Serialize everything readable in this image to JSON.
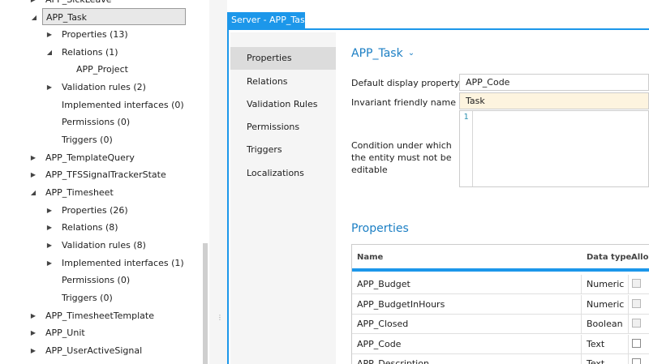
{
  "tree": {
    "items": [
      {
        "label": "APP_SickLeave",
        "expander": "expand"
      },
      {
        "label": "APP_Task",
        "expander": "collapse",
        "selected": true
      },
      {
        "label": "Properties (13)",
        "expander": "expand"
      },
      {
        "label": "Relations (1)",
        "expander": "collapse"
      },
      {
        "label": "APP_Project",
        "expander": "none"
      },
      {
        "label": "Validation rules (2)",
        "expander": "expand"
      },
      {
        "label": "Implemented interfaces (0)",
        "expander": "none"
      },
      {
        "label": "Permissions (0)",
        "expander": "none"
      },
      {
        "label": "Triggers (0)",
        "expander": "none"
      },
      {
        "label": "APP_TemplateQuery",
        "expander": "expand"
      },
      {
        "label": "APP_TFSSignalTrackerState",
        "expander": "expand"
      },
      {
        "label": "APP_Timesheet",
        "expander": "collapse"
      },
      {
        "label": "Properties (26)",
        "expander": "expand"
      },
      {
        "label": "Relations (8)",
        "expander": "expand"
      },
      {
        "label": "Validation rules (8)",
        "expander": "expand"
      },
      {
        "label": "Implemented interfaces (1)",
        "expander": "expand"
      },
      {
        "label": "Permissions (0)",
        "expander": "none"
      },
      {
        "label": "Triggers (0)",
        "expander": "none"
      },
      {
        "label": "APP_TimesheetTemplate",
        "expander": "expand"
      },
      {
        "label": "APP_Unit",
        "expander": "expand"
      },
      {
        "label": "APP_UserActiveSignal",
        "expander": "expand"
      }
    ]
  },
  "document": {
    "tab_title": "Server - APP_Task*"
  },
  "nav": {
    "items": [
      {
        "label": "Properties",
        "active": true
      },
      {
        "label": "Relations",
        "active": false
      },
      {
        "label": "Validation Rules",
        "active": false
      },
      {
        "label": "Permissions",
        "active": false
      },
      {
        "label": "Triggers",
        "active": false
      },
      {
        "label": "Localizations",
        "active": false
      }
    ]
  },
  "entity": {
    "title": "APP_Task",
    "default_display_label": "Default display property",
    "default_display_value": "APP_Code",
    "invariant_name_label": "Invariant friendly name",
    "invariant_name_value": "Task",
    "condition_label": "Condition under which the entity must not be editable",
    "editor_line_number": "1"
  },
  "properties": {
    "title": "Properties",
    "columns": {
      "name": "Name",
      "type": "Data type",
      "allow": "Allow"
    },
    "rows": [
      {
        "name": "APP_Budget",
        "type": "Numeric",
        "checkbox_enabled": false
      },
      {
        "name": "APP_BudgetInHours",
        "type": "Numeric",
        "checkbox_enabled": false
      },
      {
        "name": "APP_Closed",
        "type": "Boolean",
        "checkbox_enabled": false
      },
      {
        "name": "APP_Code",
        "type": "Text",
        "checkbox_enabled": true
      },
      {
        "name": "APP_Description",
        "type": "Text",
        "checkbox_enabled": true
      }
    ]
  },
  "colors": {
    "accent": "#1c97ea",
    "title_blue": "#1c7fc4",
    "warning_bg": "#fdf4df"
  }
}
